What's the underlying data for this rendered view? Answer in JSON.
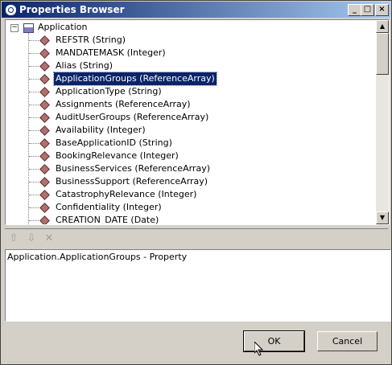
{
  "window": {
    "title": "Properties Browser"
  },
  "tree": {
    "root_label": "Application",
    "items": [
      "REFSTR (String)",
      "MANDATEMASK (Integer)",
      "Alias (String)",
      "ApplicationGroups (ReferenceArray)",
      "ApplicationType (String)",
      "Assignments (ReferenceArray)",
      "AuditUserGroups (ReferenceArray)",
      "Availability (Integer)",
      "BaseApplicationID (String)",
      "BookingRelevance (Integer)",
      "BusinessServices (ReferenceArray)",
      "BusinessSupport (ReferenceArray)",
      "CatastrophyRelevance (Integer)",
      "Confidentiality (Integer)",
      "CREATION_DATE (Date)"
    ],
    "selected_index": 3
  },
  "description": "Application.ApplicationGroups - Property",
  "buttons": {
    "ok": "OK",
    "cancel": "Cancel"
  },
  "icons": [
    "app-icon",
    "minimize-icon",
    "maximize-icon",
    "close-icon",
    "expander-icon",
    "property-icon",
    "move-up-icon",
    "move-down-icon",
    "delete-icon",
    "cursor-icon"
  ]
}
